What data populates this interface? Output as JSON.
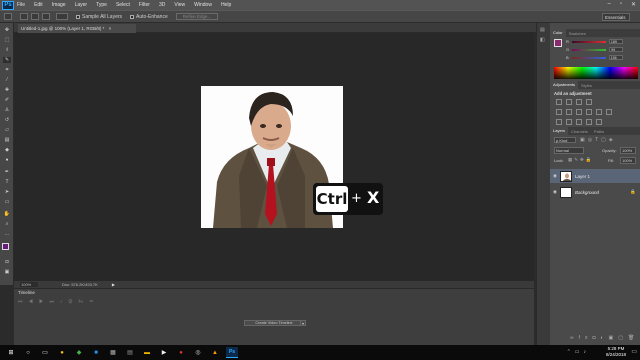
{
  "app": {
    "logo": "Ps"
  },
  "menu": [
    "File",
    "Edit",
    "Image",
    "Layer",
    "Type",
    "Select",
    "Filter",
    "3D",
    "View",
    "Window",
    "Help"
  ],
  "window_controls": [
    "–",
    "▫",
    "✕"
  ],
  "options": {
    "sample_all_layers": "Sample All Layers",
    "auto_enhance": "Auto-Enhance",
    "refine_edge": "Refine Edge...",
    "workspace": "Essentials"
  },
  "document": {
    "tab_title": "Untitled-1.jpg @ 100% (Layer 1, RGB/8) *",
    "tab_close": "×"
  },
  "status": {
    "zoom": "100%",
    "doc_size": "Doc: 576.2K/493.7K"
  },
  "timeline": {
    "tab_label": "Timeline",
    "create_button": "Create Video Timeline"
  },
  "shortcut": {
    "key1": "Ctrl",
    "plus": "+",
    "key2": "X"
  },
  "color_panel": {
    "tabs": [
      "Color",
      "Swatches"
    ],
    "sliders": [
      {
        "label": "R",
        "value": "189",
        "color": "#e03030"
      },
      {
        "label": "G",
        "value": "99",
        "color": "#30c030"
      },
      {
        "label": "B",
        "value": "156",
        "color": "#3060e0"
      }
    ],
    "fg_color": "#8a2a6e"
  },
  "adjustments_panel": {
    "tabs": [
      "Adjustments",
      "Styles"
    ],
    "heading": "Add an adjustment"
  },
  "layers_panel": {
    "tabs": [
      "Layers",
      "Channels",
      "Paths"
    ],
    "kind": "ρ Kind",
    "blend_mode": "Normal",
    "opacity_label": "Opacity:",
    "opacity": "100%",
    "lock_label": "Lock:",
    "fill_label": "Fill:",
    "fill": "100%",
    "layers": [
      {
        "name": "Layer 1",
        "selected": true
      },
      {
        "name": "Background",
        "selected": false
      }
    ]
  },
  "taskbar": {
    "icons": [
      "start-icon",
      "search-icon",
      "task-view-icon",
      "chrome-icon",
      "app-icon-green",
      "app-icon-blue",
      "calculator-icon",
      "app-icon-gray",
      "folder-icon",
      "media-icon",
      "app-icon-red",
      "app-icon-circle",
      "app-icon-orange",
      "photoshop-icon"
    ],
    "time": "5:28 PM",
    "date": "8/24/2018"
  }
}
